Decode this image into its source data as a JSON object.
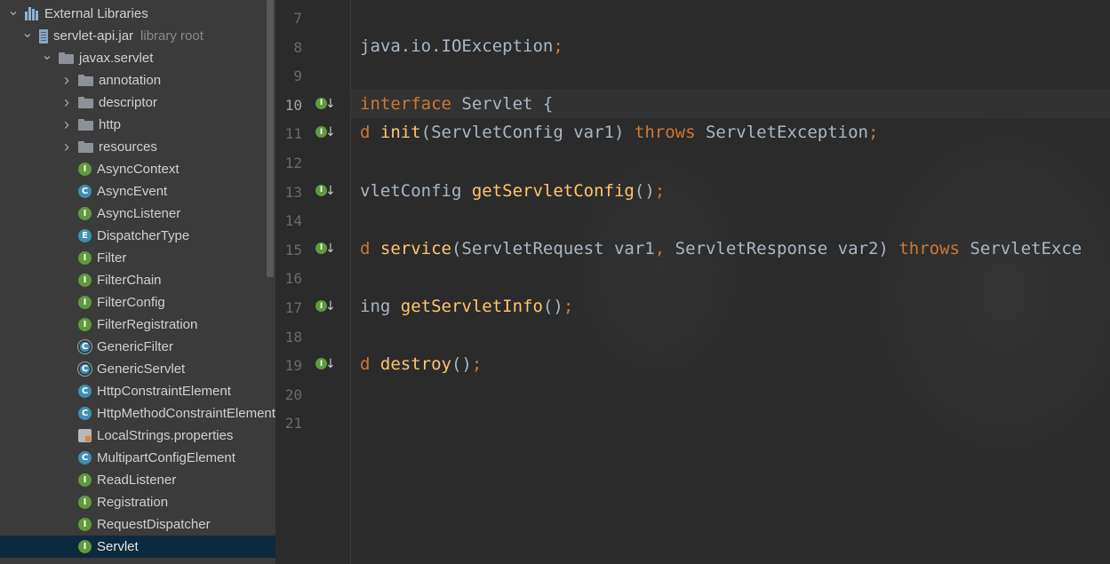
{
  "tree": {
    "rows": [
      {
        "label": "External Libraries",
        "icon": "libraries-icon",
        "arrow": "expanded",
        "level": 0
      },
      {
        "label": "servlet-api.jar",
        "hint": "library root",
        "icon": "jar-icon",
        "arrow": "expanded",
        "level": 1
      },
      {
        "label": "javax.servlet",
        "icon": "folder-icon",
        "arrow": "expanded",
        "level": 2
      },
      {
        "label": "annotation",
        "icon": "folder-icon",
        "arrow": "collapsed",
        "level": 3
      },
      {
        "label": "descriptor",
        "icon": "folder-icon",
        "arrow": "collapsed",
        "level": 3
      },
      {
        "label": "http",
        "icon": "folder-icon",
        "arrow": "collapsed",
        "level": 3
      },
      {
        "label": "resources",
        "icon": "folder-icon",
        "arrow": "collapsed",
        "level": 3
      },
      {
        "label": "AsyncContext",
        "icon": "interface-icon",
        "level": 3
      },
      {
        "label": "AsyncEvent",
        "icon": "class-icon",
        "level": 3
      },
      {
        "label": "AsyncListener",
        "icon": "interface-icon",
        "level": 3
      },
      {
        "label": "DispatcherType",
        "icon": "enum-icon",
        "level": 3
      },
      {
        "label": "Filter",
        "icon": "interface-icon",
        "level": 3
      },
      {
        "label": "FilterChain",
        "icon": "interface-icon",
        "level": 3
      },
      {
        "label": "FilterConfig",
        "icon": "interface-icon",
        "level": 3
      },
      {
        "label": "FilterRegistration",
        "icon": "interface-icon",
        "level": 3
      },
      {
        "label": "GenericFilter",
        "icon": "abstract-class-icon",
        "level": 3
      },
      {
        "label": "GenericServlet",
        "icon": "abstract-class-icon",
        "level": 3
      },
      {
        "label": "HttpConstraintElement",
        "icon": "class-icon",
        "level": 3
      },
      {
        "label": "HttpMethodConstraintElement",
        "icon": "class-icon",
        "level": 3
      },
      {
        "label": "LocalStrings.properties",
        "icon": "properties-file-icon",
        "level": 3
      },
      {
        "label": "MultipartConfigElement",
        "icon": "class-icon",
        "level": 3
      },
      {
        "label": "ReadListener",
        "icon": "interface-icon",
        "level": 3
      },
      {
        "label": "Registration",
        "icon": "interface-icon",
        "level": 3
      },
      {
        "label": "RequestDispatcher",
        "icon": "interface-icon",
        "level": 3
      },
      {
        "label": "Servlet",
        "icon": "interface-icon",
        "level": 3,
        "selected": true
      }
    ],
    "icon_letters": {
      "interface-icon": "I",
      "class-icon": "C",
      "abstract-class-icon": "C",
      "enum-icon": "E"
    }
  },
  "editor": {
    "current_line": "10",
    "lines": [
      {
        "num": "7",
        "tokens": []
      },
      {
        "num": "8",
        "tokens": [
          {
            "t": "java.io.IOException",
            "c": "pl"
          },
          {
            "t": ";",
            "c": "kw"
          }
        ]
      },
      {
        "num": "9",
        "tokens": []
      },
      {
        "num": "10",
        "gutter": "implemented-icon",
        "tokens": [
          {
            "t": "interface ",
            "c": "kw"
          },
          {
            "t": "Servlet {",
            "c": "pl"
          }
        ]
      },
      {
        "num": "11",
        "gutter": "implemented-icon",
        "tokens": [
          {
            "t": "d ",
            "c": "kw"
          },
          {
            "t": "init",
            "c": "fn"
          },
          {
            "t": "(ServletConfig var1) ",
            "c": "pl"
          },
          {
            "t": "throws ",
            "c": "kw"
          },
          {
            "t": "ServletException",
            "c": "pl"
          },
          {
            "t": ";",
            "c": "kw"
          }
        ]
      },
      {
        "num": "12",
        "tokens": []
      },
      {
        "num": "13",
        "gutter": "implemented-icon",
        "tokens": [
          {
            "t": "vletConfig ",
            "c": "pl"
          },
          {
            "t": "getServletConfig",
            "c": "fn"
          },
          {
            "t": "()",
            "c": "pl"
          },
          {
            "t": ";",
            "c": "kw"
          }
        ]
      },
      {
        "num": "14",
        "tokens": []
      },
      {
        "num": "15",
        "gutter": "implemented-icon",
        "tokens": [
          {
            "t": "d ",
            "c": "kw"
          },
          {
            "t": "service",
            "c": "fn"
          },
          {
            "t": "(ServletRequest var1",
            "c": "pl"
          },
          {
            "t": ", ",
            "c": "kw"
          },
          {
            "t": "ServletResponse var2) ",
            "c": "pl"
          },
          {
            "t": "throws ",
            "c": "kw"
          },
          {
            "t": "ServletExce",
            "c": "pl"
          }
        ]
      },
      {
        "num": "16",
        "tokens": []
      },
      {
        "num": "17",
        "gutter": "implemented-icon",
        "tokens": [
          {
            "t": "ing ",
            "c": "pl"
          },
          {
            "t": "getServletInfo",
            "c": "fn"
          },
          {
            "t": "()",
            "c": "pl"
          },
          {
            "t": ";",
            "c": "kw"
          }
        ]
      },
      {
        "num": "18",
        "tokens": []
      },
      {
        "num": "19",
        "gutter": "implemented-icon",
        "tokens": [
          {
            "t": "d ",
            "c": "kw"
          },
          {
            "t": "destroy",
            "c": "fn"
          },
          {
            "t": "()",
            "c": "pl"
          },
          {
            "t": ";",
            "c": "kw"
          }
        ]
      },
      {
        "num": "20",
        "tokens": []
      },
      {
        "num": "21",
        "tokens": []
      }
    ]
  }
}
